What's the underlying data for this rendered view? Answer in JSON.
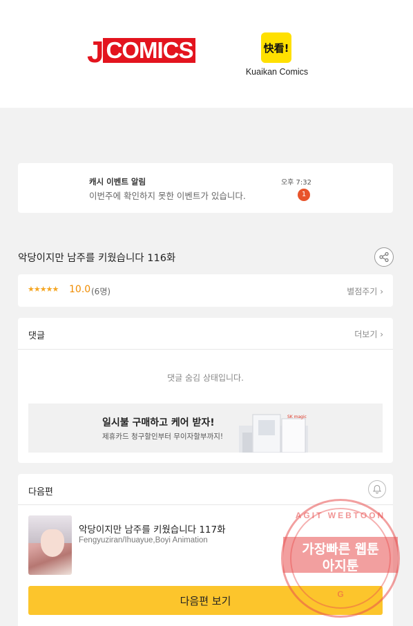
{
  "header": {
    "jcomics_logo": "JCOMICS",
    "kuaikan_logo": "快看!",
    "kuaikan_name": "Kuaikan Comics"
  },
  "notice": {
    "title": "캐시 이벤트 알림",
    "message": "이번주에 확인하지 못한 이벤트가 있습니다.",
    "time": "오후 7:32",
    "badge": "1"
  },
  "episode": {
    "title": "악당이지만 남주를 키웠습니다 116화",
    "share_icon": "share-icon"
  },
  "rating": {
    "stars": "★★★★★",
    "score": "10.0",
    "count": "(6명)",
    "rate_button": "별점주기"
  },
  "comments": {
    "heading": "댓글",
    "more": "더보기",
    "hidden_message": "댓글 숨김 상태입니다."
  },
  "ad": {
    "headline": "일시불 구매하고 케어 받자!",
    "subtext": "제휴카드 청구할인부터 무이자할부까지!",
    "brand_mark": "SK magic"
  },
  "next_episode": {
    "heading": "다음편",
    "bell_icon": "bell-icon",
    "title": "악당이지만 남주를 키웠습니다 117화",
    "authors": "Fengyuziran/Ihuayue,Boyi Animation",
    "cta": "다음편 보기"
  },
  "watermark": {
    "line1": "가장빠른 웹툰",
    "line2": "아지툰",
    "arc_text": "AGIT WEBTOON",
    "bottom_text": "G"
  },
  "colors": {
    "brand_red": "#e3141e",
    "kuaikan_yellow": "#ffe000",
    "cta_yellow": "#fcc52c",
    "star": "#f5a623",
    "badge": "#e8542b"
  }
}
